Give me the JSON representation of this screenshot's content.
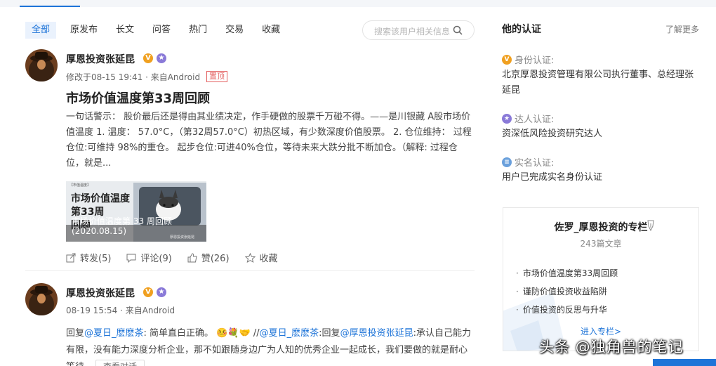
{
  "tabs": [
    "全部",
    "原发布",
    "长文",
    "问答",
    "热门",
    "交易",
    "收藏"
  ],
  "search": {
    "placeholder": "搜索该用户相关信息"
  },
  "posts": [
    {
      "user": "厚恩投资张延昆",
      "meta": "修改于08-15 19:41 · 来自Android",
      "pin": "置顶",
      "title": "市场价值温度第33周回顾",
      "excerpt": "一句话警示： 股价最后还是得由其业绩决定，作手硬做的股票千万碰不得。——是川银藏 A股市场价值温度 1. 温度： 57.0°C，（第32周57.0°C）初热区域，有少数深度价值股票。 2. 仓位维持： 过程仓位:可维持 98%的重仓。 起步仓位:可进40%仓位，等待未来大跌分批不断加仓。（解释: 过程仓位，就是...",
      "thumb": {
        "tag": "【市值温度】",
        "line1": "市场价值温度",
        "line2": "第33周",
        "line3": "回顾",
        "overlay": "市场价值温度第 33 周回顾",
        "date": "(2020.08.15)",
        "caption": "厚恩投资张延昆"
      },
      "actions": {
        "forward": "转发(5)",
        "comment": "评论(9)",
        "like": "赞(26)",
        "collect": "收藏"
      }
    },
    {
      "user": "厚恩投资张延昆",
      "meta": "08-19 15:54 · 来自Android",
      "reply": {
        "prefix": "回复",
        "at1": "@夏日_麽麽茶",
        "text1": ": 简单直白正确。",
        "emoji": "🤒💐🤝",
        "sep": " //",
        "at2": "@夏日_麽麽茶",
        "text2": ":回复",
        "at3": "@厚恩投资张延昆",
        "text3": ":承认自己能力有限，没有能力深度分析企业，那不如跟随身边广为人知的优秀企业一起成长，我们要做的就是耐心等待",
        "view": "查看对话"
      }
    }
  ],
  "cert": {
    "title": "他的认证",
    "more": "了解更多",
    "items": [
      {
        "label": "身份认证:",
        "text": "北京厚恩投资管理有限公司执行董事、总经理张延昆",
        "color": "#f0a020",
        "mark": "V"
      },
      {
        "label": "达人认证:",
        "text": "资深低风险投资研究达人",
        "color": "#8a7ad8",
        "mark": "★"
      },
      {
        "label": "实名认证:",
        "text": "用户已完成实名身份认证",
        "color": "#6aa0dc",
        "mark": "≡"
      }
    ]
  },
  "column": {
    "name": "佐罗_厚恩投资的专栏",
    "count": "243篇文章",
    "articles": [
      "市场价值温度第33周回顾",
      "谨防价值投资收益陷阱",
      "价值投资的反思与升华"
    ],
    "enter": "进入专栏>"
  },
  "watermark": "头条 @独角兽的笔记",
  "colors": {
    "accent": "#1e74d8",
    "pin": "#e35f5f",
    "vbadge": "#f0a020",
    "starbadge": "#8a7ad8"
  }
}
